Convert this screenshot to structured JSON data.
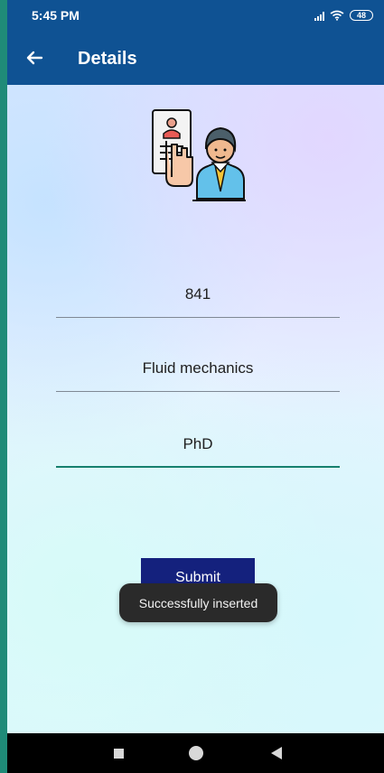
{
  "status_bar": {
    "time": "5:45 PM",
    "battery": "48",
    "icons": [
      "signal-icon",
      "wifi-icon",
      "battery-icon"
    ]
  },
  "app_bar": {
    "title": "Details",
    "back_icon": "arrow-left-icon"
  },
  "illustration": {
    "name": "teacher-document-illustration"
  },
  "form": {
    "fields": [
      {
        "value": "841"
      },
      {
        "value": "Fluid mechanics"
      },
      {
        "value": "PhD"
      }
    ],
    "submit_label": "Submit"
  },
  "toast": {
    "message": "Successfully inserted"
  },
  "nav_bar": {
    "icons": [
      "recent-apps-icon",
      "home-icon",
      "back-icon"
    ]
  },
  "colors": {
    "primary": "#0f5293",
    "button": "#14217d",
    "accent": "#16806e",
    "toast": "#2a2a2a"
  }
}
